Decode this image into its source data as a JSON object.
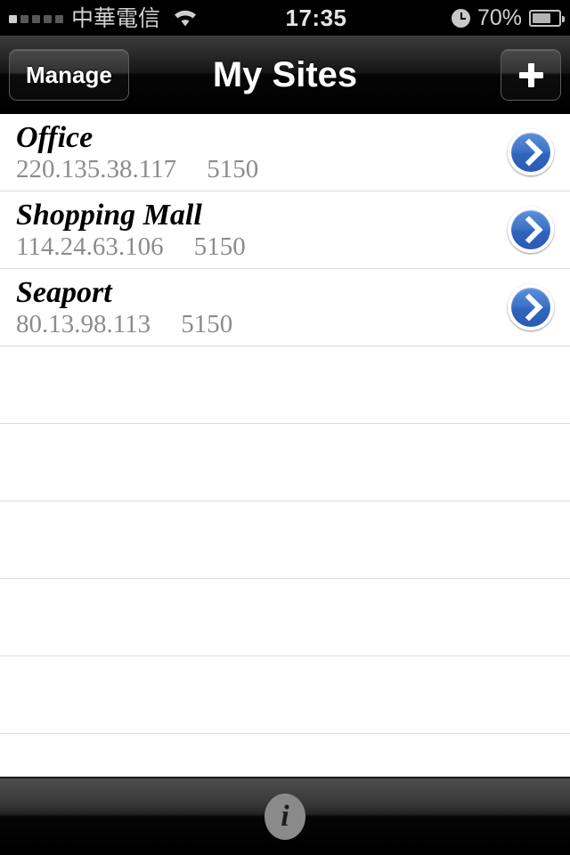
{
  "status_bar": {
    "carrier": "中華電信",
    "signal_icon": "signal-bars-icon",
    "signal_bars_filled": 1,
    "signal_bars_total": 5,
    "wifi_icon": "wifi-icon",
    "time": "17:35",
    "alarm_icon": "clock-icon",
    "battery_percent": "70%",
    "battery_level": 70,
    "battery_icon": "battery-icon"
  },
  "nav_bar": {
    "left_button": "Manage",
    "title": "My Sites",
    "right_button_icon": "plus-icon"
  },
  "list": {
    "rows": [
      {
        "name": "Office",
        "ip": "220.135.38.117",
        "port": "5150",
        "accessory_icon": "chevron-right-icon"
      },
      {
        "name": "Shopping Mall",
        "ip": "114.24.63.106",
        "port": "5150",
        "accessory_icon": "chevron-right-icon"
      },
      {
        "name": "Seaport",
        "ip": "80.13.98.113",
        "port": "5150",
        "accessory_icon": "chevron-right-icon"
      }
    ],
    "empty_row_count": 5
  },
  "toolbar": {
    "info_button_icon": "info-icon",
    "info_glyph": "i"
  },
  "colors": {
    "accent_blue": "#3f75c8",
    "separator": "#dcdcdc",
    "subtitle_gray": "#8c8c8c",
    "bar_black": "#000000"
  }
}
